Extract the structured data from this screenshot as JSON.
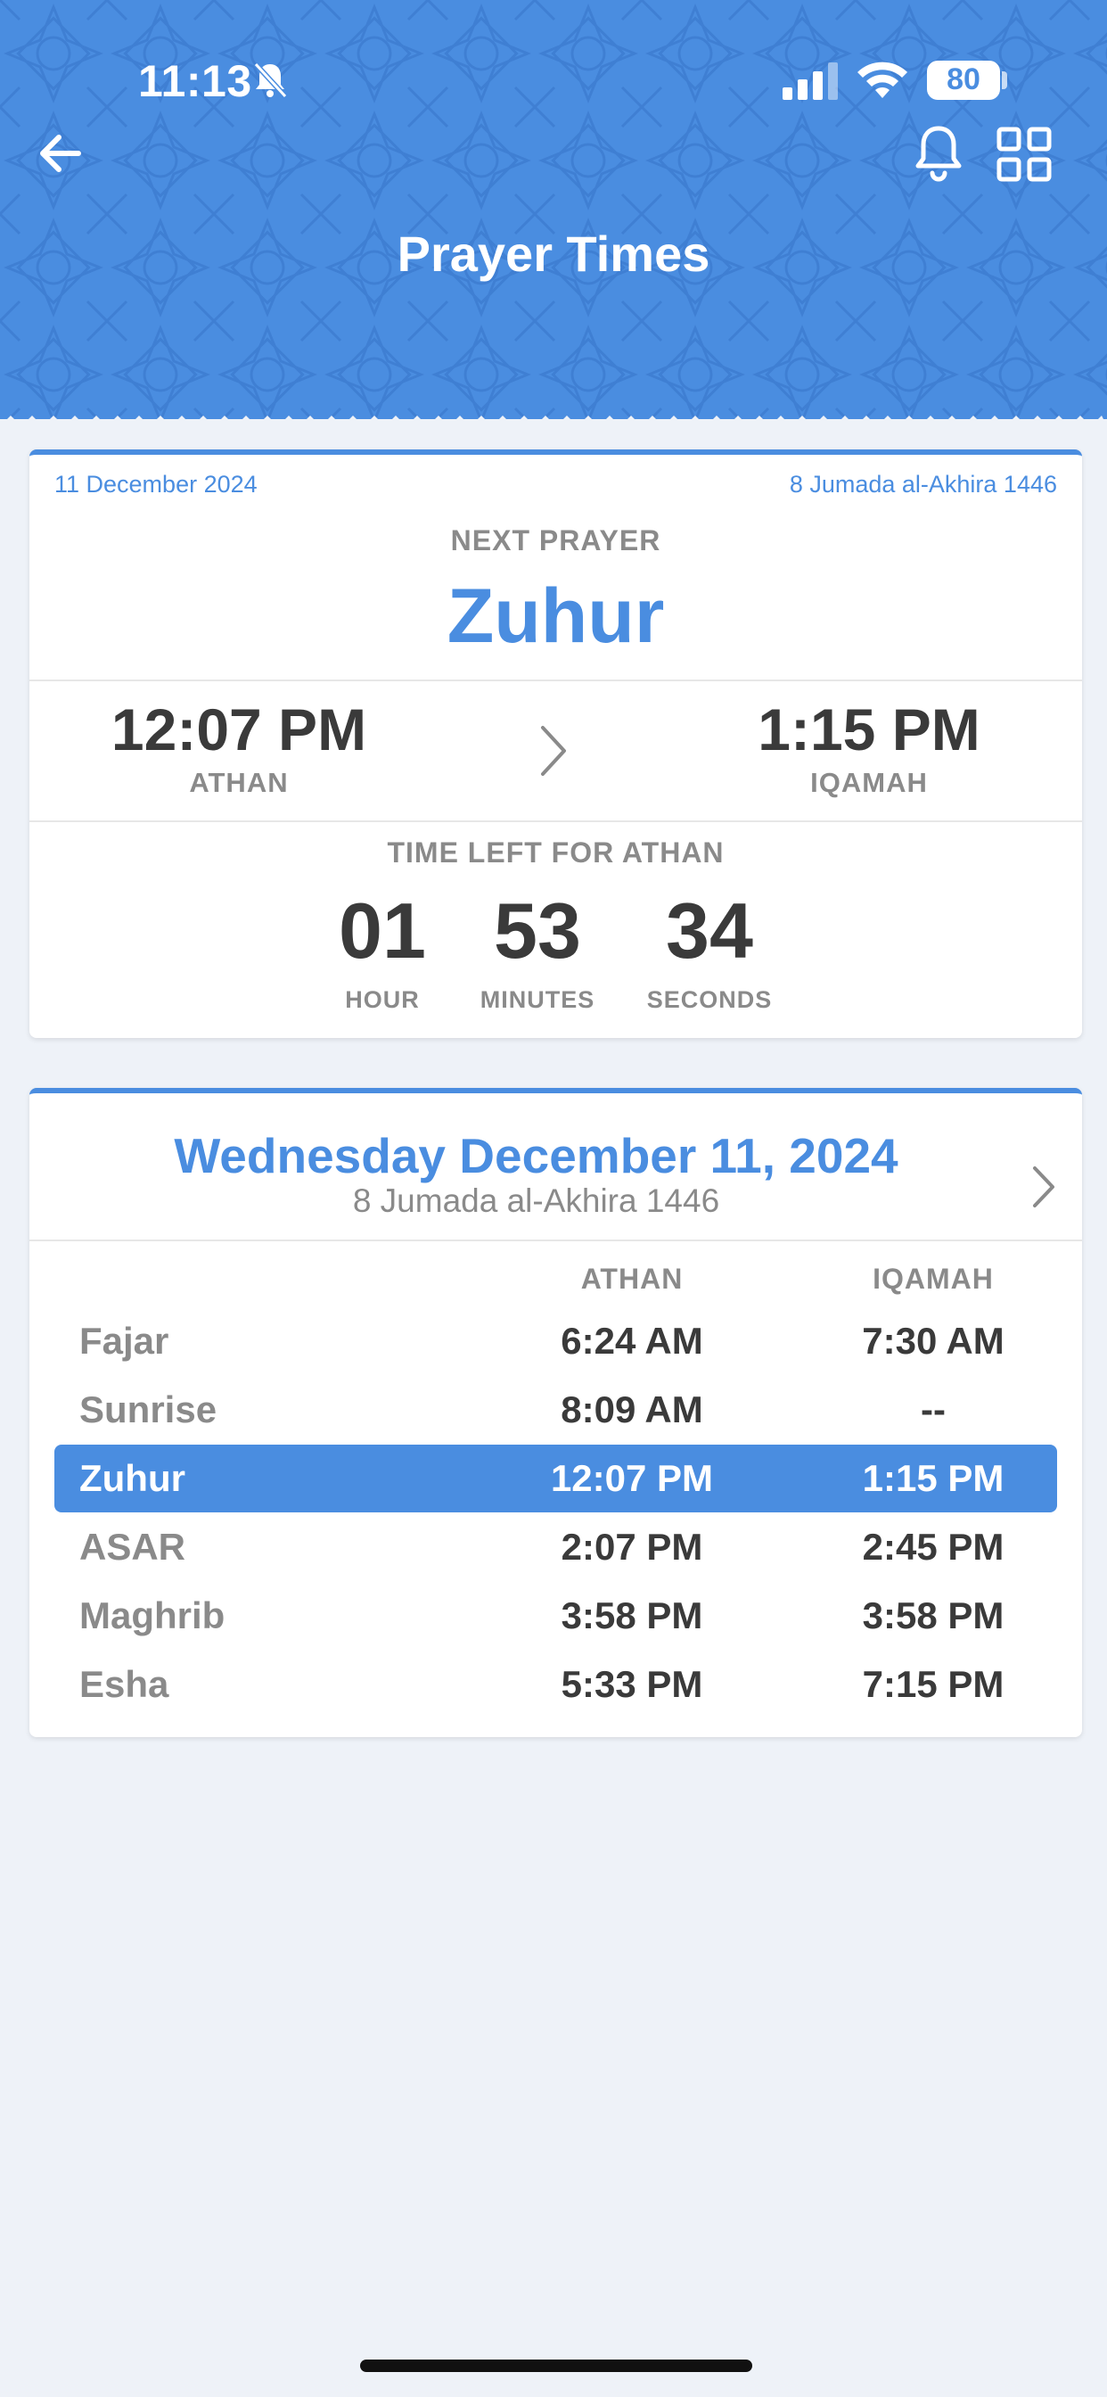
{
  "status_bar": {
    "time": "11:13",
    "battery": "80",
    "icons": [
      "bell-slash-icon",
      "cellular-signal-icon",
      "wifi-icon",
      "battery-icon"
    ]
  },
  "header": {
    "title": "Prayer Times",
    "icons": [
      "arrow-left-icon",
      "bell-icon",
      "grid-icon"
    ],
    "color": "#4a8de0"
  },
  "next_prayer": {
    "gregorian_date": "11 December 2024",
    "hijri_date": "8 Jumada al-Akhira 1446",
    "label": "NEXT PRAYER",
    "name": "Zuhur",
    "athan_time": "12:07 PM",
    "athan_label": "ATHAN",
    "iqamah_time": "1:15 PM",
    "iqamah_label": "IQAMAH",
    "time_left_label": "TIME LEFT FOR ATHAN",
    "countdown": {
      "hours": "01",
      "hours_label": "HOUR",
      "minutes": "53",
      "minutes_label": "MINUTES",
      "seconds": "34",
      "seconds_label": "SECONDS"
    }
  },
  "day_schedule": {
    "title": "Wednesday December 11, 2024",
    "hijri": "8 Jumada al-Akhira 1446",
    "columns": {
      "athan": "ATHAN",
      "iqamah": "IQAMAH"
    },
    "rows": [
      {
        "name": "Fajar",
        "athan": "6:24 AM",
        "iqamah": "7:30 AM",
        "active": false
      },
      {
        "name": "Sunrise",
        "athan": "8:09 AM",
        "iqamah": "--",
        "active": false
      },
      {
        "name": "Zuhur",
        "athan": "12:07 PM",
        "iqamah": "1:15 PM",
        "active": true
      },
      {
        "name": "ASAR",
        "athan": "2:07 PM",
        "iqamah": "2:45 PM",
        "active": false
      },
      {
        "name": "Maghrib",
        "athan": "3:58 PM",
        "iqamah": "3:58 PM",
        "active": false
      },
      {
        "name": "Esha",
        "athan": "5:33 PM",
        "iqamah": "7:15 PM",
        "active": false
      }
    ]
  },
  "colors": {
    "accent": "#4a8de0",
    "background": "#eef2f8",
    "muted_text": "#8a8a8a",
    "dark_text": "#3a3a3a"
  }
}
